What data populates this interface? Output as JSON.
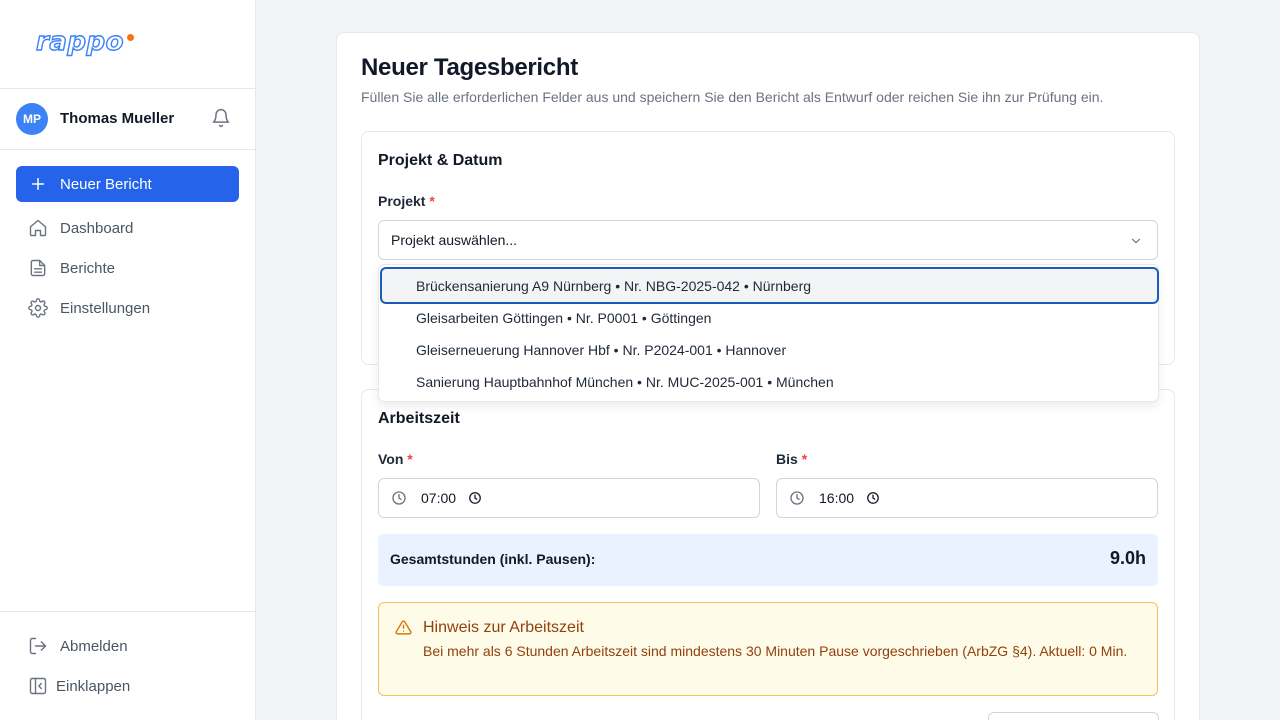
{
  "sidebar": {
    "logo_text": "rappo",
    "user": {
      "initials": "MP",
      "name": "Thomas Mueller"
    },
    "new_report_label": "Neuer Bericht",
    "nav": [
      {
        "label": "Dashboard",
        "icon": "home-icon"
      },
      {
        "label": "Berichte",
        "icon": "document-icon"
      },
      {
        "label": "Einstellungen",
        "icon": "gear-icon"
      }
    ],
    "bottom": [
      {
        "label": "Abmelden",
        "icon": "logout-icon"
      },
      {
        "label": "Einklappen",
        "icon": "collapse-icon"
      }
    ]
  },
  "page": {
    "title": "Neuer Tagesbericht",
    "subtitle": "Füllen Sie alle erforderlichen Felder aus und speichern Sie den Bericht als Entwurf oder reichen Sie ihn zur Prüfung ein."
  },
  "project_section": {
    "title": "Projekt & Datum",
    "project_label": "Projekt",
    "required_mark": "*",
    "select_placeholder": "Projekt auswählen...",
    "options": [
      "Brückensanierung A9 Nürnberg • Nr. NBG-2025-042 • Nürnberg",
      "Gleisarbeiten Göttingen • Nr. P0001 • Göttingen",
      "Gleiserneuerung Hannover Hbf • Nr. P2024-001 • Hannover",
      "Sanierung Hauptbahnhof München • Nr. MUC-2025-001 • München"
    ]
  },
  "worktime_section": {
    "title": "Arbeitszeit",
    "from_label": "Von",
    "to_label": "Bis",
    "required_mark": "*",
    "from_value": "07:00",
    "to_value": "16:00",
    "total_label": "Gesamtstunden (inkl. Pausen):",
    "total_value": "9.0h"
  },
  "warning": {
    "title": "Hinweis zur Arbeitszeit",
    "text": "Bei mehr als 6 Stunden Arbeitszeit sind mindestens 30 Minuten Pause vorgeschrieben (ArbZG §4). Aktuell: 0 Min."
  },
  "colors": {
    "primary": "#2563eb",
    "brand_accent": "#f97316",
    "warning_bg": "#fefce8",
    "warning_text": "#92400e",
    "total_bg": "#eaf1ff"
  }
}
